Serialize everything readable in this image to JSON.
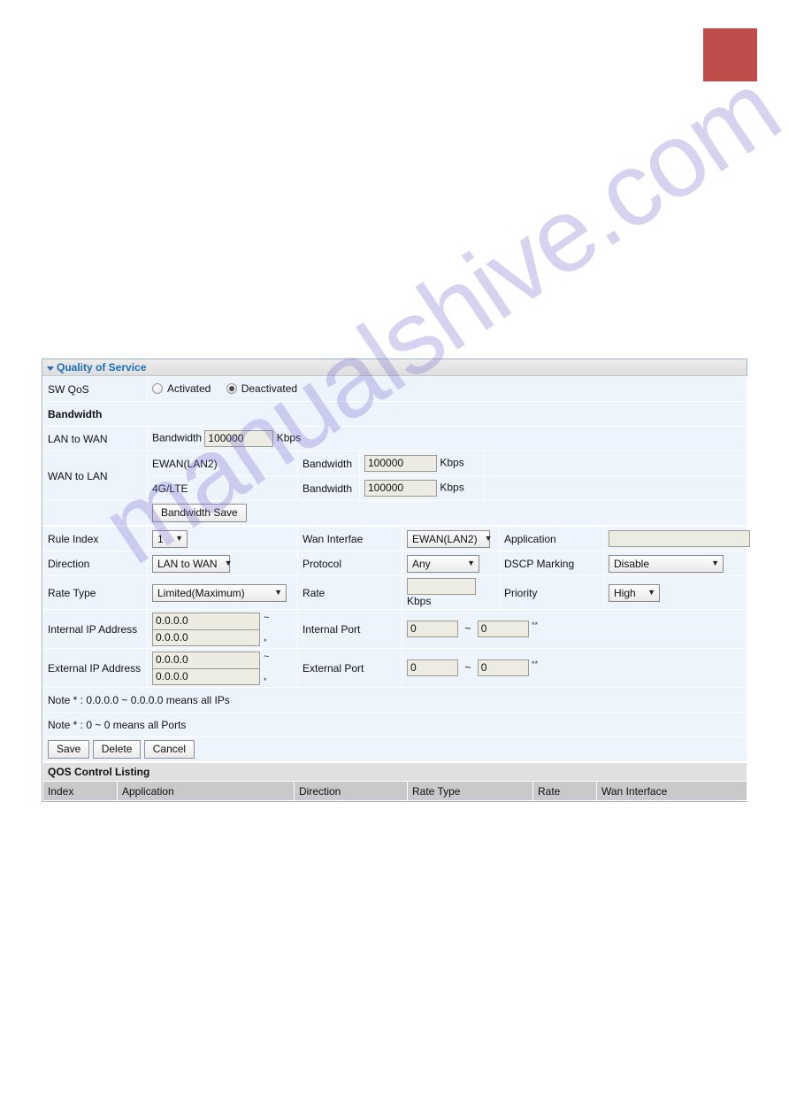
{
  "page": {
    "red_block_color": "#c04b4b",
    "watermark_text": "manualshive.com",
    "watermark_color": "#786ed2"
  },
  "panel": {
    "title": "Quality of Service",
    "sw_qos": {
      "label": "SW QoS",
      "options": [
        {
          "label": "Activated",
          "selected": false
        },
        {
          "label": "Deactivated",
          "selected": true
        }
      ]
    },
    "bandwidth_section": {
      "title": "Bandwidth",
      "lan_to_wan": {
        "label": "LAN to WAN",
        "field_label": "Bandwidth",
        "value": "100000",
        "unit": "Kbps"
      },
      "wan_to_lan": {
        "label": "WAN to LAN",
        "rows": [
          {
            "name": "EWAN(LAN2)",
            "field_label": "Bandwidth",
            "value": "100000",
            "unit": "Kbps"
          },
          {
            "name": "4G/LTE",
            "field_label": "Bandwidth",
            "value": "100000",
            "unit": "Kbps"
          }
        ]
      },
      "save_button": "Bandwidth Save"
    },
    "rule": {
      "rule_index": {
        "label": "Rule Index",
        "value": "1"
      },
      "wan_interface": {
        "label": "Wan Interfae",
        "value": "EWAN(LAN2)"
      },
      "application": {
        "label": "Application",
        "value": ""
      },
      "direction": {
        "label": "Direction",
        "value": "LAN to WAN"
      },
      "protocol": {
        "label": "Protocol",
        "value": "Any"
      },
      "dscp_marking": {
        "label": "DSCP Marking",
        "value": "Disable"
      },
      "rate_type": {
        "label": "Rate Type",
        "value": "Limited(Maximum)"
      },
      "rate": {
        "label": "Rate",
        "value": "",
        "unit": "Kbps"
      },
      "priority": {
        "label": "Priority",
        "value": "High"
      },
      "internal_ip": {
        "label": "Internal IP Address",
        "from": "0.0.0.0",
        "to": "0.0.0.0",
        "sep": "~",
        "mark": "*"
      },
      "internal_port": {
        "label": "Internal Port",
        "from": "0",
        "to": "0",
        "sep": "~",
        "mark": "**"
      },
      "external_ip": {
        "label": "External IP Address",
        "from": "0.0.0.0",
        "to": "0.0.0.0",
        "sep": "~",
        "mark": "*"
      },
      "external_port": {
        "label": "External Port",
        "from": "0",
        "to": "0",
        "sep": "~",
        "mark": "**"
      }
    },
    "notes": [
      "Note * : 0.0.0.0 ~ 0.0.0.0 means all IPs",
      "Note * : 0 ~ 0 means all Ports"
    ],
    "actions": {
      "save": "Save",
      "delete": "Delete",
      "cancel": "Cancel"
    },
    "listing": {
      "title": "QOS Control Listing",
      "columns": [
        "Index",
        "Application",
        "Direction",
        "Rate Type",
        "Rate",
        "Wan Interface"
      ],
      "rows": []
    }
  }
}
